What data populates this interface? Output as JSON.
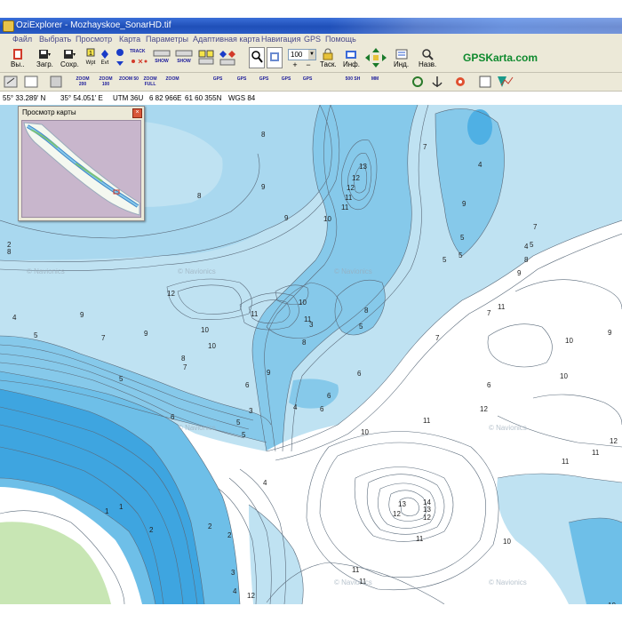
{
  "window": {
    "title": "OziExplorer - Mozhayskoe_SonarHD.tif"
  },
  "menu": [
    "Файл",
    "Выбрать",
    "Просмотр",
    "Карта",
    "Параметры",
    "Адаптивная карта",
    "Навигация",
    "GPS",
    "Помощь"
  ],
  "toolbar1": {
    "exit_label": "Вы..",
    "load_label": "Загр.",
    "save_label": "Сохр.",
    "wpt_label": "Wpt",
    "evt_label": "Evt",
    "track_label": "TRACK",
    "show_label": "SHOW",
    "zoom_value": "100",
    "task_label": "Таск.",
    "info_label": "Инф.",
    "ind_label": "Инд.",
    "name_label": "Назв."
  },
  "brand": "GPSKarta.com",
  "toolbar2": {
    "zoom_labels": [
      "ZOOM 200",
      "ZOOM 100",
      "ZOOM 50",
      "ZOOM FULL",
      "ZOOM"
    ],
    "gps_labels": [
      "GPS",
      "GPS",
      "GPS",
      "GPS",
      "GPS"
    ],
    "speed_label": "500 SH",
    "unit_label": "MM"
  },
  "status": {
    "lat": "55° 33.289' N",
    "lon": "35° 54.051' E",
    "utm": "UTM  36U",
    "east": "6 82 966E",
    "north": "61 60 355N",
    "datum": "WGS 84"
  },
  "overview": {
    "title": "Просмотр карты"
  },
  "map": {
    "watermark": "© Navionics",
    "depths": [
      "13",
      "12",
      "11",
      "11",
      "10",
      "12",
      "12",
      "11",
      "10",
      "10",
      "9",
      "9",
      "9",
      "9",
      "8",
      "8",
      "8",
      "8",
      "7",
      "7",
      "7",
      "7",
      "6",
      "6",
      "6",
      "5",
      "5",
      "5",
      "5",
      "5",
      "4",
      "4",
      "4",
      "3",
      "2",
      "2",
      "2",
      "1",
      "1",
      "3",
      "4",
      "11",
      "12",
      "13",
      "14",
      "13",
      "12",
      "11",
      "10",
      "10",
      "12",
      "11",
      "10",
      "9",
      "9",
      "8",
      "10",
      "11",
      "11",
      "5",
      "6",
      "4",
      "3",
      "2",
      "8",
      "5",
      "6",
      "12",
      "11",
      "12",
      "11",
      "10",
      "9",
      "8",
      "7",
      "7",
      "6",
      "5",
      "4",
      "5",
      "9",
      "10",
      "11"
    ],
    "colors": {
      "shallow": "#ffffff",
      "mid": "#bfe2f2",
      "deep": "#6ebfe8",
      "deepest": "#2e97dc",
      "land": "#c8e6b4"
    }
  }
}
